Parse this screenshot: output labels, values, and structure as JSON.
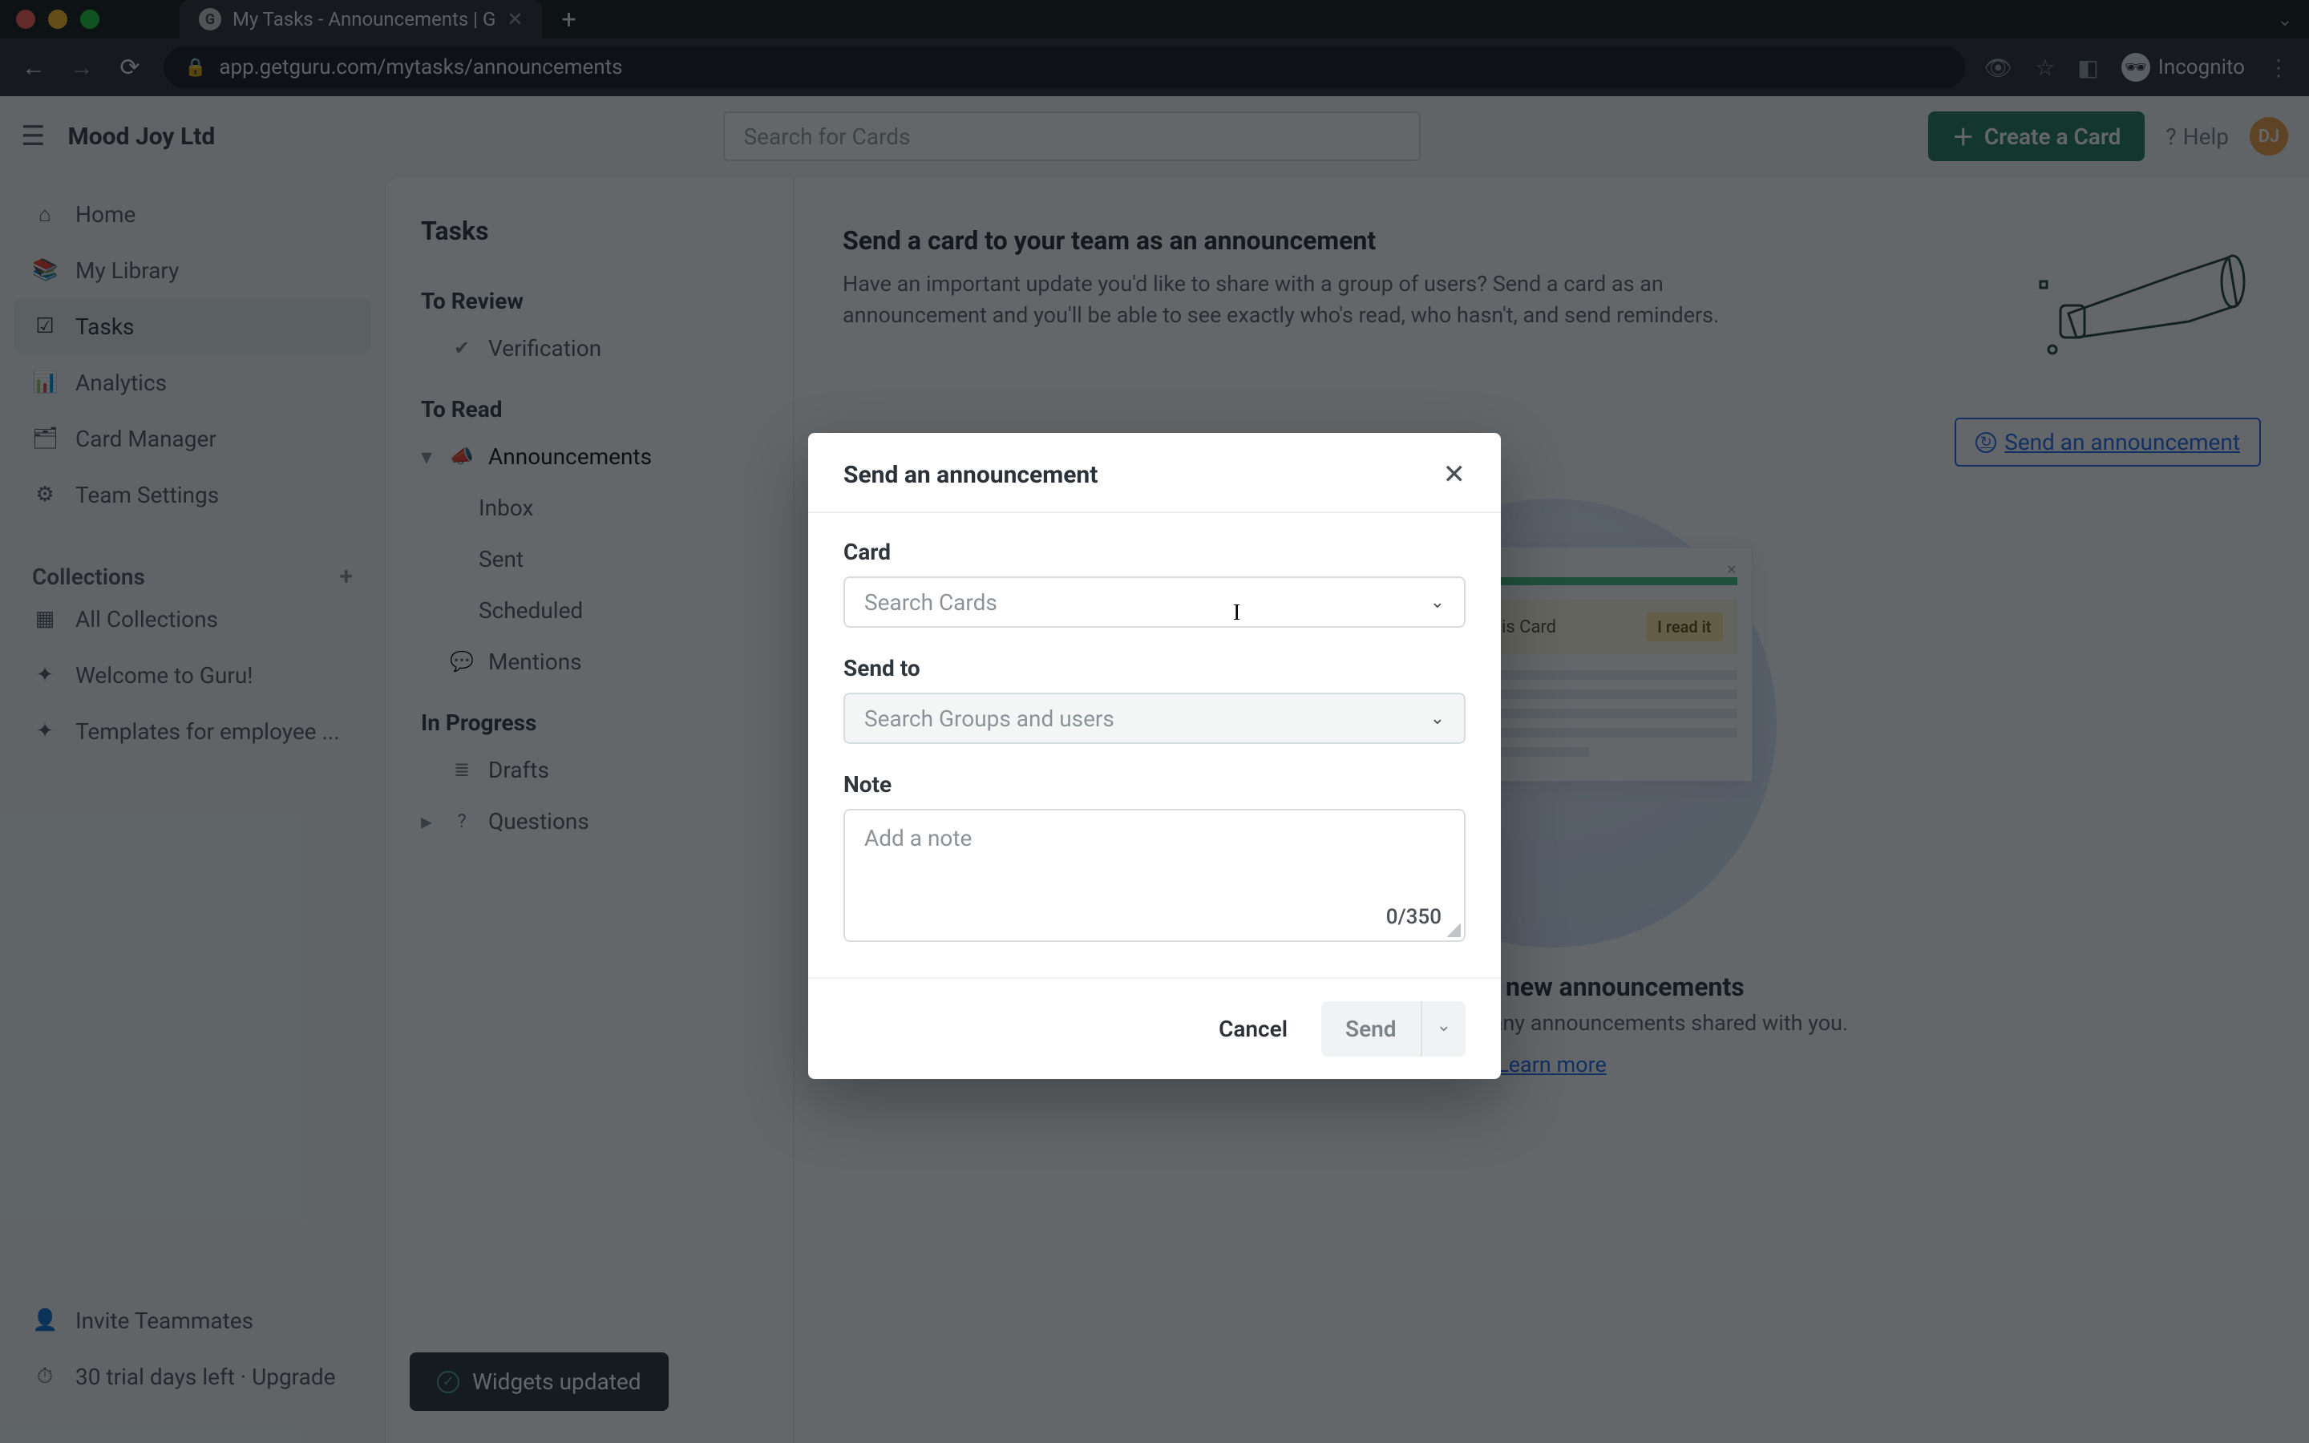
{
  "browser": {
    "tab_title": "My Tasks - Announcements | G",
    "url": "app.getguru.com/mytasks/announcements",
    "incognito_label": "Incognito"
  },
  "header": {
    "org_name": "Mood Joy Ltd",
    "search_placeholder": "Search for Cards",
    "create_card_label": "Create a Card",
    "help_label": "Help",
    "avatar_initials": "DJ"
  },
  "sidebar": {
    "items": [
      {
        "icon": "⌂",
        "label": "Home"
      },
      {
        "icon": "📚",
        "label": "My Library"
      },
      {
        "icon": "☑",
        "label": "Tasks"
      },
      {
        "icon": "📊",
        "label": "Analytics"
      },
      {
        "icon": "🗂",
        "label": "Card Manager"
      },
      {
        "icon": "⚙",
        "label": "Team Settings"
      }
    ],
    "collections_label": "Collections",
    "collections": [
      {
        "icon": "▦",
        "label": "All Collections"
      },
      {
        "icon": "✦",
        "label": "Welcome to Guru!"
      },
      {
        "icon": "✦",
        "label": "Templates for employee ..."
      }
    ],
    "footer": {
      "invite_label": "Invite Teammates",
      "trial_label": "30 trial days left · Upgrade"
    }
  },
  "tasks_nav": {
    "title": "Tasks",
    "sections": [
      {
        "label": "To Review",
        "items": [
          {
            "icon": "✔",
            "label": "Verification"
          }
        ]
      },
      {
        "label": "To Read",
        "items": [
          {
            "icon": "📣",
            "label": "Announcements",
            "expanded": true,
            "children": [
              {
                "label": "Inbox"
              },
              {
                "label": "Sent"
              },
              {
                "label": "Scheduled"
              }
            ]
          },
          {
            "icon": "💬",
            "label": "Mentions"
          }
        ]
      },
      {
        "label": "In Progress",
        "items": [
          {
            "icon": "≣",
            "label": "Drafts"
          },
          {
            "icon": "?",
            "label": "Questions"
          }
        ]
      }
    ],
    "snackbar_label": "Widgets updated"
  },
  "main": {
    "banner_title": "Send a card to your team as an announcement",
    "banner_desc": "Have an important update you'd like to share with a group of users? Send a card as an announcement and you'll be able to see exactly who's read, who hasn't, and send reminders.",
    "send_link_label": "Send an announcement",
    "illus_note_text": "...at you read this Card",
    "illus_read_btn": "I read it",
    "empty_title": "You have no new announcements",
    "empty_desc": "You'll be notified here of any announcements shared with you.",
    "learn_more_label": "Learn more"
  },
  "modal": {
    "title": "Send an announcement",
    "card_label": "Card",
    "card_placeholder": "Search Cards",
    "sendto_label": "Send to",
    "sendto_placeholder": "Search Groups and users",
    "note_label": "Note",
    "note_placeholder": "Add a note",
    "char_count": "0/350",
    "cancel_label": "Cancel",
    "send_label": "Send"
  }
}
